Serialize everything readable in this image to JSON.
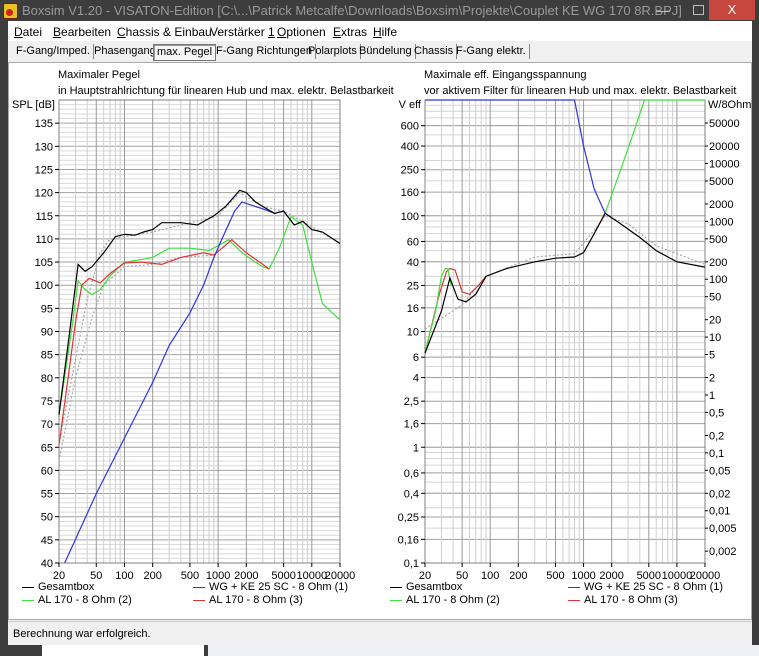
{
  "window": {
    "title": "Boxsim V1.20 - VISATON-Edition [C:\\...\\Patrick Metcalfe\\Downloads\\Boxsim\\Projekte\\Couplet KE WG 170 8R.BPJ]",
    "minimize": "—",
    "close": "X"
  },
  "menu": [
    {
      "label": "Datei"
    },
    {
      "label": "Bearbeiten"
    },
    {
      "label": "Chassis & Einbau"
    },
    {
      "label": "Verstärker ",
      "accel": "1"
    },
    {
      "label": "Optionen"
    },
    {
      "label": "Extras"
    },
    {
      "label": "Hilfe"
    }
  ],
  "tabs": [
    {
      "label": "F-Gang/Imped."
    },
    {
      "label": "Phasengang"
    },
    {
      "label": "max. Pegel",
      "active": true
    },
    {
      "label": "F-Gang Richtungen"
    },
    {
      "label": "Polarplots"
    },
    {
      "label": "Bündelung"
    },
    {
      "label": "Chassis"
    },
    {
      "label": "F-Gang elektr."
    }
  ],
  "status": "Berechnung war erfolgreich.",
  "colors": {
    "gesamt": "#000000",
    "wg": "#3333dd",
    "al2": "#3fe03f",
    "al3": "#e03333",
    "ref": "#a8a8a8"
  },
  "chart_data": [
    {
      "type": "line",
      "title": "Maximaler Pegel",
      "subtitle": "in Hauptstrahlrichtung für linearen Hub und max. elektr. Belastbarkeit",
      "ylabel": "SPL [dB]",
      "xscale": "log",
      "xlim": [
        20,
        20000
      ],
      "ylim": [
        40,
        140
      ],
      "xticks": [
        "20",
        "50",
        "100",
        "200",
        "500",
        "1000",
        "2000",
        "5000",
        "10000",
        "20000"
      ],
      "yticks": [
        "40",
        "45",
        "50",
        "55",
        "60",
        "65",
        "70",
        "75",
        "80",
        "85",
        "90",
        "95",
        "100",
        "105",
        "110",
        "115",
        "120",
        "125",
        "130",
        "135"
      ],
      "grid": true,
      "legend": [
        "Gesamtbox",
        "WG + KE 25 SC - 8 Ohm (1)",
        "AL 170 - 8 Ohm (2)",
        "AL 170 - 8 Ohm (3)"
      ],
      "series": [
        {
          "name": "Gesamtbox (ref)",
          "color_key": "ref",
          "dashed": true,
          "points": [
            [
              20,
              66
            ],
            [
              30,
              84
            ],
            [
              40,
              97
            ],
            [
              55,
              107
            ],
            [
              70,
              110
            ],
            [
              100,
              110.5
            ],
            [
              200,
              111.5
            ],
            [
              400,
              113
            ],
            [
              1000,
              115
            ],
            [
              1700,
              120
            ],
            [
              3000,
              117
            ],
            [
              5000,
              116
            ],
            [
              8000,
              113.8
            ],
            [
              20000,
              109
            ]
          ]
        },
        {
          "name": "AL 170 - 8 Ohm (ref)",
          "color_key": "ref",
          "dashed": true,
          "points": [
            [
              20,
              62
            ],
            [
              30,
              80
            ],
            [
              45,
              93
            ],
            [
              60,
              100
            ],
            [
              100,
              104
            ],
            [
              200,
              104.5
            ],
            [
              400,
              106
            ],
            [
              900,
              106.5
            ]
          ]
        },
        {
          "name": "AL 170 - 8 Ohm (2)",
          "color_key": "al2",
          "points": [
            [
              20,
              72
            ],
            [
              28,
              92
            ],
            [
              32,
              101
            ],
            [
              38,
              99
            ],
            [
              45,
              98
            ],
            [
              55,
              99
            ],
            [
              70,
              102
            ],
            [
              100,
              105
            ],
            [
              150,
              105.5
            ],
            [
              200,
              106
            ],
            [
              300,
              108
            ],
            [
              500,
              108
            ],
            [
              800,
              107.5
            ],
            [
              1300,
              109.8
            ],
            [
              1800,
              107
            ],
            [
              2500,
              105
            ],
            [
              3000,
              104
            ],
            [
              3500,
              103.5
            ],
            [
              4500,
              108
            ],
            [
              6000,
              114.8
            ],
            [
              8000,
              113
            ],
            [
              10000,
              105
            ],
            [
              13000,
              96
            ],
            [
              20000,
              92.5
            ]
          ]
        },
        {
          "name": "AL 170 - 8 Ohm (3)",
          "color_key": "al3",
          "points": [
            [
              20,
              65.5
            ],
            [
              25,
              80
            ],
            [
              30,
              92
            ],
            [
              35,
              100
            ],
            [
              42,
              101.5
            ],
            [
              55,
              100.5
            ],
            [
              70,
              102.5
            ],
            [
              100,
              104.8
            ],
            [
              150,
              105
            ],
            [
              250,
              104.5
            ],
            [
              400,
              106
            ],
            [
              700,
              107
            ],
            [
              900,
              106.5
            ],
            [
              1400,
              109.8
            ],
            [
              2000,
              107
            ],
            [
              3000,
              104.5
            ],
            [
              3500,
              103.5
            ]
          ]
        },
        {
          "name": "WG + KE 25 SC - 8 Ohm (1)",
          "color_key": "wg",
          "points": [
            [
              23,
              40
            ],
            [
              50,
              55
            ],
            [
              100,
              67
            ],
            [
              200,
              79
            ],
            [
              300,
              87
            ],
            [
              500,
              94
            ],
            [
              700,
              100
            ],
            [
              900,
              106
            ],
            [
              1100,
              110
            ],
            [
              1500,
              116
            ],
            [
              1800,
              118
            ],
            [
              2500,
              117
            ],
            [
              3000,
              116.5
            ],
            [
              4000,
              115.5
            ],
            [
              5000,
              116
            ]
          ]
        },
        {
          "name": "Gesamtbox",
          "color_key": "gesamt",
          "points": [
            [
              20,
              72
            ],
            [
              26,
              90
            ],
            [
              32,
              104.5
            ],
            [
              38,
              103
            ],
            [
              45,
              104
            ],
            [
              60,
              107
            ],
            [
              80,
              110.5
            ],
            [
              100,
              111
            ],
            [
              130,
              110.8
            ],
            [
              160,
              111.5
            ],
            [
              200,
              112
            ],
            [
              250,
              113.5
            ],
            [
              400,
              113.5
            ],
            [
              600,
              113
            ],
            [
              900,
              115
            ],
            [
              1200,
              117
            ],
            [
              1700,
              120.5
            ],
            [
              2000,
              120
            ],
            [
              2500,
              118
            ],
            [
              3000,
              117
            ],
            [
              4000,
              115.5
            ],
            [
              5000,
              116
            ],
            [
              6500,
              113
            ],
            [
              8000,
              113.8
            ],
            [
              10000,
              112
            ],
            [
              13000,
              111.5
            ],
            [
              20000,
              109
            ]
          ]
        }
      ]
    },
    {
      "type": "line",
      "title": "Maximale eff. Eingangsspannung",
      "subtitle": "vor aktivem Filter für linearen Hub und max. elektr. Belastbarkeit",
      "ylabel": "V eff",
      "y2label": "W/8Ohm",
      "xscale": "log",
      "yscale": "log",
      "xlim": [
        20,
        20000
      ],
      "ylim": [
        0.1,
        1000
      ],
      "xticks": [
        "20",
        "50",
        "100",
        "200",
        "500",
        "1000",
        "2000",
        "5000",
        "10000",
        "20000"
      ],
      "yticks": [
        {
          "v": 600,
          "label": "600"
        },
        {
          "v": 400,
          "label": "400"
        },
        {
          "v": 250,
          "label": "250"
        },
        {
          "v": 160,
          "label": "160"
        },
        {
          "v": 100,
          "label": "100"
        },
        {
          "v": 60,
          "label": "60"
        },
        {
          "v": 40,
          "label": "40"
        },
        {
          "v": 25,
          "label": "25"
        },
        {
          "v": 16,
          "label": "16"
        },
        {
          "v": 10,
          "label": "10"
        },
        {
          "v": 6,
          "label": "6"
        },
        {
          "v": 4,
          "label": "4"
        },
        {
          "v": 2.5,
          "label": "2,5"
        },
        {
          "v": 1.6,
          "label": "1,6"
        },
        {
          "v": 1,
          "label": "1"
        },
        {
          "v": 0.6,
          "label": "0,6"
        },
        {
          "v": 0.4,
          "label": "0,4"
        },
        {
          "v": 0.25,
          "label": "0,25"
        },
        {
          "v": 0.16,
          "label": "0,16"
        },
        {
          "v": 0.1,
          "label": "0,1"
        }
      ],
      "y2ticks": [
        {
          "w": 50000,
          "label": "50000"
        },
        {
          "w": 20000,
          "label": "20000"
        },
        {
          "w": 10000,
          "label": "10000"
        },
        {
          "w": 5000,
          "label": "5000"
        },
        {
          "w": 2000,
          "label": "2000"
        },
        {
          "w": 1000,
          "label": "1000"
        },
        {
          "w": 500,
          "label": "500"
        },
        {
          "w": 200,
          "label": "200"
        },
        {
          "w": 100,
          "label": "100"
        },
        {
          "w": 50,
          "label": "50"
        },
        {
          "w": 20,
          "label": "20"
        },
        {
          "w": 10,
          "label": "10"
        },
        {
          "w": 5,
          "label": "5"
        },
        {
          "w": 2,
          "label": "2"
        },
        {
          "w": 1,
          "label": "1"
        },
        {
          "w": 0.5,
          "label": "0,5"
        },
        {
          "w": 0.2,
          "label": "0,2"
        },
        {
          "w": 0.1,
          "label": "0,1"
        },
        {
          "w": 0.05,
          "label": "0,05"
        },
        {
          "w": 0.02,
          "label": "0,02"
        },
        {
          "w": 0.01,
          "label": "0,01"
        },
        {
          "w": 0.005,
          "label": "0,005"
        },
        {
          "w": 0.002,
          "label": "0,002"
        }
      ],
      "grid": true,
      "legend": [
        "Gesamtbox",
        "WG + KE 25 SC - 8 Ohm (1)",
        "AL 170 - 8 Ohm (2)",
        "AL 170 - 8 Ohm (3)"
      ],
      "series": [
        {
          "name": "Gesamtbox (ref)",
          "color_key": "ref",
          "dashed": true,
          "points": [
            [
              20,
              10.5
            ],
            [
              50,
              17
            ],
            [
              90,
              30
            ],
            [
              300,
              44
            ],
            [
              800,
              47
            ],
            [
              1300,
              75
            ],
            [
              1700,
              100
            ],
            [
              3000,
              85
            ],
            [
              6000,
              55
            ],
            [
              20000,
              38
            ]
          ]
        },
        {
          "name": "AL 170 - 8 Ohm (3)",
          "color_key": "al3",
          "points": [
            [
              20,
              6.5
            ],
            [
              28,
              20
            ],
            [
              34,
              33
            ],
            [
              37,
              35
            ],
            [
              42,
              34
            ],
            [
              50,
              22
            ],
            [
              60,
              21
            ],
            [
              75,
              25
            ],
            [
              90,
              30
            ]
          ]
        },
        {
          "name": "AL 170 - 8 Ohm (2) low",
          "color_key": "al2",
          "points": [
            [
              20,
              6.5
            ],
            [
              26,
              15
            ],
            [
              30,
              30
            ],
            [
              33,
              35
            ],
            [
              35,
              35
            ],
            [
              38,
              25
            ]
          ]
        },
        {
          "name": "AL 170 - 8 Ohm (2)",
          "color_key": "al2",
          "points": [
            [
              1700,
              105
            ],
            [
              2500,
              250
            ],
            [
              3500,
              550
            ],
            [
              4500,
              1000
            ],
            [
              20000,
              1000
            ]
          ]
        },
        {
          "name": "WG + KE 25 SC - 8 Ohm (1)",
          "color_key": "wg",
          "points": [
            [
              20,
              1000
            ],
            [
              800,
              1000
            ],
            [
              1000,
              400
            ],
            [
              1300,
              170
            ],
            [
              1700,
              105
            ]
          ]
        },
        {
          "name": "Gesamtbox",
          "color_key": "gesamt",
          "points": [
            [
              20,
              6.5
            ],
            [
              30,
              15
            ],
            [
              37,
              29
            ],
            [
              45,
              19
            ],
            [
              55,
              18
            ],
            [
              70,
              21
            ],
            [
              90,
              30
            ],
            [
              150,
              35
            ],
            [
              300,
              40
            ],
            [
              500,
              43
            ],
            [
              800,
              44
            ],
            [
              1000,
              48
            ],
            [
              1300,
              70
            ],
            [
              1700,
              105
            ],
            [
              2500,
              85
            ],
            [
              4000,
              65
            ],
            [
              6000,
              50
            ],
            [
              10000,
              40
            ],
            [
              20000,
              36
            ]
          ]
        }
      ]
    }
  ]
}
